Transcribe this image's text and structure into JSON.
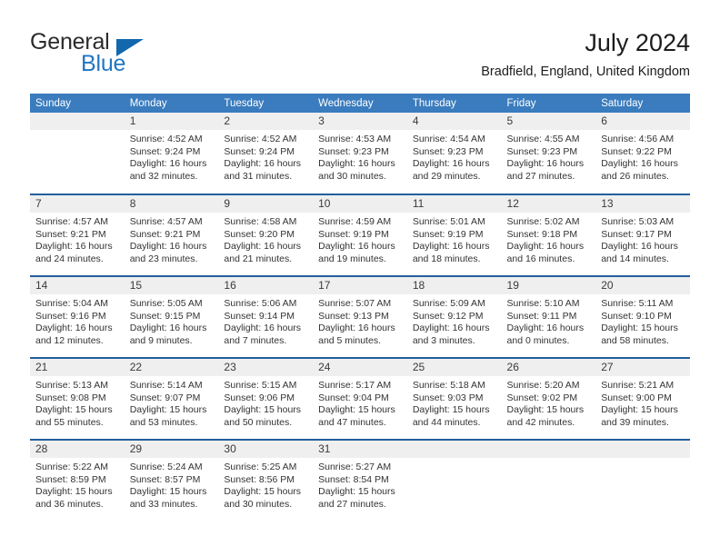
{
  "brand": {
    "name_part1": "General",
    "name_part2": "Blue",
    "accent_color": "#1267ad",
    "blue_text_color": "#2077c4"
  },
  "header": {
    "title": "July 2024",
    "location": "Bradfield, England, United Kingdom"
  },
  "theme": {
    "header_row_bg": "#3a7cbe",
    "week_divider": "#225f9e",
    "daynum_band_bg": "#efefef",
    "text_color": "#333333"
  },
  "weekday_headers": [
    "Sunday",
    "Monday",
    "Tuesday",
    "Wednesday",
    "Thursday",
    "Friday",
    "Saturday"
  ],
  "weeks": [
    [
      {
        "day": "",
        "blank": true,
        "sunrise": "",
        "sunset": "",
        "daylight1": "",
        "daylight2": ""
      },
      {
        "day": "1",
        "sunrise": "Sunrise: 4:52 AM",
        "sunset": "Sunset: 9:24 PM",
        "daylight1": "Daylight: 16 hours",
        "daylight2": "and 32 minutes."
      },
      {
        "day": "2",
        "sunrise": "Sunrise: 4:52 AM",
        "sunset": "Sunset: 9:24 PM",
        "daylight1": "Daylight: 16 hours",
        "daylight2": "and 31 minutes."
      },
      {
        "day": "3",
        "sunrise": "Sunrise: 4:53 AM",
        "sunset": "Sunset: 9:23 PM",
        "daylight1": "Daylight: 16 hours",
        "daylight2": "and 30 minutes."
      },
      {
        "day": "4",
        "sunrise": "Sunrise: 4:54 AM",
        "sunset": "Sunset: 9:23 PM",
        "daylight1": "Daylight: 16 hours",
        "daylight2": "and 29 minutes."
      },
      {
        "day": "5",
        "sunrise": "Sunrise: 4:55 AM",
        "sunset": "Sunset: 9:23 PM",
        "daylight1": "Daylight: 16 hours",
        "daylight2": "and 27 minutes."
      },
      {
        "day": "6",
        "sunrise": "Sunrise: 4:56 AM",
        "sunset": "Sunset: 9:22 PM",
        "daylight1": "Daylight: 16 hours",
        "daylight2": "and 26 minutes."
      }
    ],
    [
      {
        "day": "7",
        "sunrise": "Sunrise: 4:57 AM",
        "sunset": "Sunset: 9:21 PM",
        "daylight1": "Daylight: 16 hours",
        "daylight2": "and 24 minutes."
      },
      {
        "day": "8",
        "sunrise": "Sunrise: 4:57 AM",
        "sunset": "Sunset: 9:21 PM",
        "daylight1": "Daylight: 16 hours",
        "daylight2": "and 23 minutes."
      },
      {
        "day": "9",
        "sunrise": "Sunrise: 4:58 AM",
        "sunset": "Sunset: 9:20 PM",
        "daylight1": "Daylight: 16 hours",
        "daylight2": "and 21 minutes."
      },
      {
        "day": "10",
        "sunrise": "Sunrise: 4:59 AM",
        "sunset": "Sunset: 9:19 PM",
        "daylight1": "Daylight: 16 hours",
        "daylight2": "and 19 minutes."
      },
      {
        "day": "11",
        "sunrise": "Sunrise: 5:01 AM",
        "sunset": "Sunset: 9:19 PM",
        "daylight1": "Daylight: 16 hours",
        "daylight2": "and 18 minutes."
      },
      {
        "day": "12",
        "sunrise": "Sunrise: 5:02 AM",
        "sunset": "Sunset: 9:18 PM",
        "daylight1": "Daylight: 16 hours",
        "daylight2": "and 16 minutes."
      },
      {
        "day": "13",
        "sunrise": "Sunrise: 5:03 AM",
        "sunset": "Sunset: 9:17 PM",
        "daylight1": "Daylight: 16 hours",
        "daylight2": "and 14 minutes."
      }
    ],
    [
      {
        "day": "14",
        "sunrise": "Sunrise: 5:04 AM",
        "sunset": "Sunset: 9:16 PM",
        "daylight1": "Daylight: 16 hours",
        "daylight2": "and 12 minutes."
      },
      {
        "day": "15",
        "sunrise": "Sunrise: 5:05 AM",
        "sunset": "Sunset: 9:15 PM",
        "daylight1": "Daylight: 16 hours",
        "daylight2": "and 9 minutes."
      },
      {
        "day": "16",
        "sunrise": "Sunrise: 5:06 AM",
        "sunset": "Sunset: 9:14 PM",
        "daylight1": "Daylight: 16 hours",
        "daylight2": "and 7 minutes."
      },
      {
        "day": "17",
        "sunrise": "Sunrise: 5:07 AM",
        "sunset": "Sunset: 9:13 PM",
        "daylight1": "Daylight: 16 hours",
        "daylight2": "and 5 minutes."
      },
      {
        "day": "18",
        "sunrise": "Sunrise: 5:09 AM",
        "sunset": "Sunset: 9:12 PM",
        "daylight1": "Daylight: 16 hours",
        "daylight2": "and 3 minutes."
      },
      {
        "day": "19",
        "sunrise": "Sunrise: 5:10 AM",
        "sunset": "Sunset: 9:11 PM",
        "daylight1": "Daylight: 16 hours",
        "daylight2": "and 0 minutes."
      },
      {
        "day": "20",
        "sunrise": "Sunrise: 5:11 AM",
        "sunset": "Sunset: 9:10 PM",
        "daylight1": "Daylight: 15 hours",
        "daylight2": "and 58 minutes."
      }
    ],
    [
      {
        "day": "21",
        "sunrise": "Sunrise: 5:13 AM",
        "sunset": "Sunset: 9:08 PM",
        "daylight1": "Daylight: 15 hours",
        "daylight2": "and 55 minutes."
      },
      {
        "day": "22",
        "sunrise": "Sunrise: 5:14 AM",
        "sunset": "Sunset: 9:07 PM",
        "daylight1": "Daylight: 15 hours",
        "daylight2": "and 53 minutes."
      },
      {
        "day": "23",
        "sunrise": "Sunrise: 5:15 AM",
        "sunset": "Sunset: 9:06 PM",
        "daylight1": "Daylight: 15 hours",
        "daylight2": "and 50 minutes."
      },
      {
        "day": "24",
        "sunrise": "Sunrise: 5:17 AM",
        "sunset": "Sunset: 9:04 PM",
        "daylight1": "Daylight: 15 hours",
        "daylight2": "and 47 minutes."
      },
      {
        "day": "25",
        "sunrise": "Sunrise: 5:18 AM",
        "sunset": "Sunset: 9:03 PM",
        "daylight1": "Daylight: 15 hours",
        "daylight2": "and 44 minutes."
      },
      {
        "day": "26",
        "sunrise": "Sunrise: 5:20 AM",
        "sunset": "Sunset: 9:02 PM",
        "daylight1": "Daylight: 15 hours",
        "daylight2": "and 42 minutes."
      },
      {
        "day": "27",
        "sunrise": "Sunrise: 5:21 AM",
        "sunset": "Sunset: 9:00 PM",
        "daylight1": "Daylight: 15 hours",
        "daylight2": "and 39 minutes."
      }
    ],
    [
      {
        "day": "28",
        "sunrise": "Sunrise: 5:22 AM",
        "sunset": "Sunset: 8:59 PM",
        "daylight1": "Daylight: 15 hours",
        "daylight2": "and 36 minutes."
      },
      {
        "day": "29",
        "sunrise": "Sunrise: 5:24 AM",
        "sunset": "Sunset: 8:57 PM",
        "daylight1": "Daylight: 15 hours",
        "daylight2": "and 33 minutes."
      },
      {
        "day": "30",
        "sunrise": "Sunrise: 5:25 AM",
        "sunset": "Sunset: 8:56 PM",
        "daylight1": "Daylight: 15 hours",
        "daylight2": "and 30 minutes."
      },
      {
        "day": "31",
        "sunrise": "Sunrise: 5:27 AM",
        "sunset": "Sunset: 8:54 PM",
        "daylight1": "Daylight: 15 hours",
        "daylight2": "and 27 minutes."
      },
      {
        "day": "",
        "blank": true,
        "sunrise": "",
        "sunset": "",
        "daylight1": "",
        "daylight2": ""
      },
      {
        "day": "",
        "blank": true,
        "sunrise": "",
        "sunset": "",
        "daylight1": "",
        "daylight2": ""
      },
      {
        "day": "",
        "blank": true,
        "sunrise": "",
        "sunset": "",
        "daylight1": "",
        "daylight2": ""
      }
    ]
  ]
}
